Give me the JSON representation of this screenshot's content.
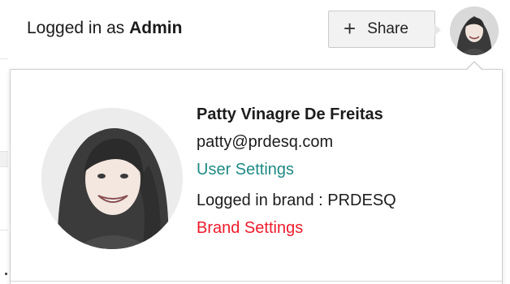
{
  "header": {
    "status_prefix": "Logged in as ",
    "status_role": "Admin",
    "share_icon": "+",
    "share_label": "Share"
  },
  "profile": {
    "name": "Patty Vinagre De Freitas",
    "email": "patty@prdesq.com",
    "user_settings_label": "User Settings",
    "brand_prefix": "Logged in brand : ",
    "brand_name": "PRDESQ",
    "brand_settings_label": "Brand Settings",
    "avatar_icon": "user-photo-avatar"
  },
  "colors": {
    "user_settings_link": "#1f8a84",
    "brand_settings_link": "#ee1c2c",
    "share_button_bg": "#f2f2f2"
  }
}
